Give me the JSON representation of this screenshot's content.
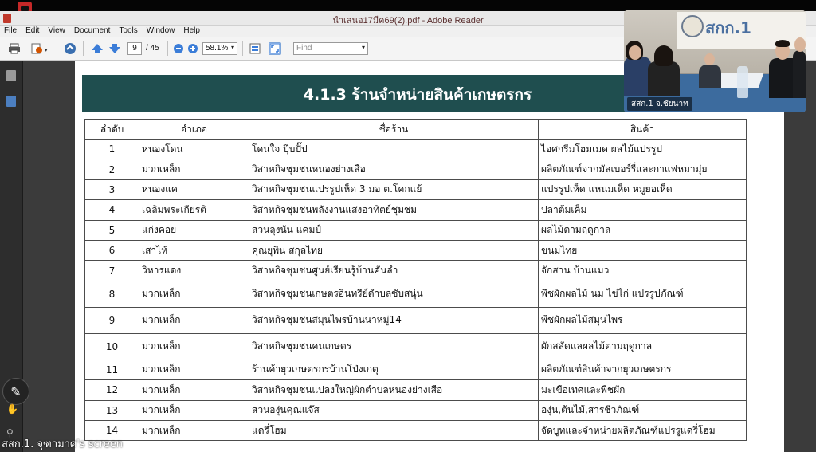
{
  "window": {
    "title": "นำเสนอ17มีค69(2).pdf - Adobe Reader"
  },
  "menu": [
    "File",
    "Edit",
    "View",
    "Document",
    "Tools",
    "Window",
    "Help"
  ],
  "toolbar": {
    "page_current": "9",
    "page_total": "/ 45",
    "zoom": "58.1%",
    "find_placeholder": "Find"
  },
  "slide": {
    "heading": "4.1.3 ร้านจำหน่ายสินค้าเกษตรกร",
    "columns": [
      "ลำดับ",
      "อำเภอ",
      "ชื่อร้าน",
      "สินค้า"
    ],
    "rows": [
      {
        "no": "1",
        "district": "หนองโดน",
        "shop": "โดนใจ ปุ๊บปั๊ป",
        "product": "ไอศกรีมโฮมเมด  ผลไม้แปรรูป"
      },
      {
        "no": "2",
        "district": "มวกเหล็ก",
        "shop": "วิสาหกิจชุมชนหนองย่างเสือ",
        "product": "ผลิตภัณฑ์จากมัลเบอร์รี่และกาแฟหมามุ่ย"
      },
      {
        "no": "3",
        "district": "หนองแค",
        "shop": "วิสาหกิจชุมชนแปรรูปเห็ด 3 มอ  ต.โคกแย้",
        "product": "แปรรูปเห็ด แหนมเห็ด  หมูยอเห็ด"
      },
      {
        "no": "4",
        "district": "เฉลิมพระเกียรติ",
        "shop": "วิสาหกิจชุมชนพลังงานแสงอาทิตย์ชุมชม",
        "product": "ปลาต้มเค็ม"
      },
      {
        "no": "5",
        "district": "แก่งคอย",
        "shop": "สวนลุงนัน แคมป์",
        "product": "ผลไม้ตามฤดูกาล"
      },
      {
        "no": "6",
        "district": "เสาไห้",
        "shop": "คุณยุพิน สกุลไทย",
        "product": "ขนมไทย"
      },
      {
        "no": "7",
        "district": "วิหารแดง",
        "shop": "วิสาหกิจชุมชนศูนย์เรียนรู้บ้านคันลำ",
        "product": "จักสาน บ้านแมว"
      },
      {
        "no": "8",
        "district": "มวกเหล็ก",
        "shop": "วิสาหกิจชุมชนเกษตรอินทรีย์ตำบลซับสนุ่น",
        "product": "พืชผักผลไม้ นม ไข่ไก่ แปรรูปภัณฑ์"
      },
      {
        "no": "9",
        "district": "มวกเหล็ก",
        "shop": "วิสาหกิจชุมชนสมุนไพรบ้านนาหมู่14",
        "product": "พืชผักผลไม้สมุนไพร"
      },
      {
        "no": "10",
        "district": "มวกเหล็ก",
        "shop": "วิสาหกิจชุมชนคนเกษตร",
        "product": "ผักสลัดแลผลไม้ตามฤดูกาล"
      },
      {
        "no": "11",
        "district": "มวกเหล็ก",
        "shop": "ร้านค้ายุวเกษตรกรบ้านโป่งเกตุ",
        "product": "ผลิตภัณฑ์สินค้าจากยุวเกษตรกร"
      },
      {
        "no": "12",
        "district": "มวกเหล็ก",
        "shop": "วิสาหกิจชุมชนแปลงใหญ่ผักตำบลหนองย่างเสือ",
        "product": "มะเขือเทศและพืชผัก"
      },
      {
        "no": "13",
        "district": "มวกเหล็ก",
        "shop": "สวนองุ่นคุณแจ๊ส",
        "product": "องุ่น,ต้นไม้,สารชีวภัณฑ์"
      },
      {
        "no": "14",
        "district": "มวกเหล็ก",
        "shop": "แดรี่โฮม",
        "product": "จัดบูทและจำหน่ายผลิตภัณฑ์แปรรูแดรี่โฮม"
      }
    ]
  },
  "video": {
    "org": "สกก.1",
    "label": "สสก.1 จ.ชัยนาท"
  },
  "presenter": "สสก.1. จุฑามาศ's screen",
  "icons": [
    "app-logo-icon",
    "pdf-icon",
    "print-icon",
    "export-icon",
    "share-icon",
    "prev-page-icon",
    "next-page-icon",
    "zoom-out-icon",
    "zoom-in-icon",
    "fit-page-icon",
    "fit-width-icon",
    "pages-icon",
    "bookmark-icon",
    "pen-icon",
    "reaction-icon",
    "pin-icon"
  ]
}
